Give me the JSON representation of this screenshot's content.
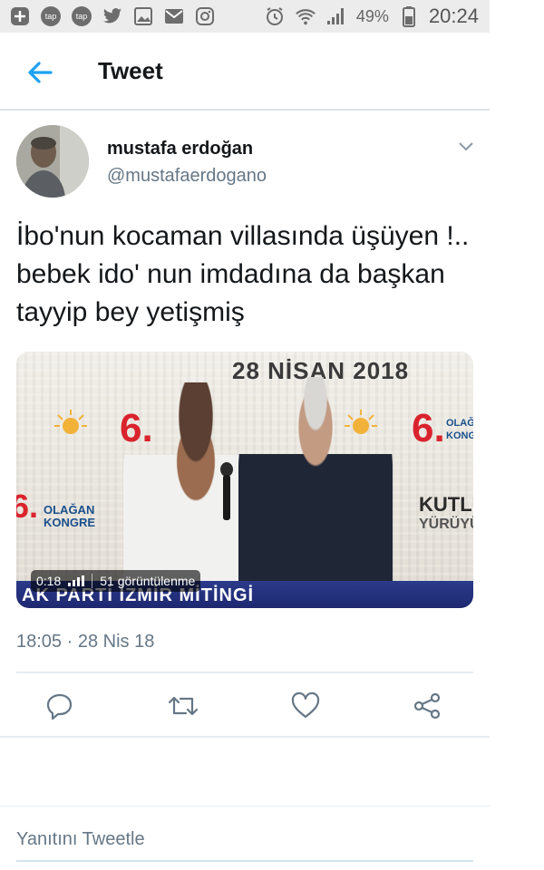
{
  "status_bar": {
    "left_icons": [
      "plus-box-icon",
      "tap-app-icon",
      "tap-app-icon",
      "twitter-icon",
      "gallery-icon",
      "mail-icon",
      "instagram-icon"
    ],
    "tap_label_1": "tap",
    "tap_label_2": "tap",
    "battery_percent": "49%",
    "time": "20:24"
  },
  "header": {
    "title": "Tweet"
  },
  "tweet": {
    "author_name": "mustafa erdoğan",
    "author_handle": "@mustafaerdogano",
    "text": "İbo'nun kocaman villasında üşüyen !.. bebek ido' nun imdadına da başkan tayyip bey yetişmiş",
    "timestamp": "18:05 · 28 Nis 18"
  },
  "media": {
    "date_banner": "28 NİSAN 2018",
    "big_number": "6.",
    "olagan_kongre": "OLAĞAN KONGRE",
    "kutlu": "KUTLU",
    "yuruyus": "YÜRÜYÜŞ",
    "bottom_banner": "AK PARTİ İZMİR MİTİNGİ",
    "duration": "0:18",
    "views": "51 görüntülenme"
  },
  "actions": {
    "reply": "reply-icon",
    "retweet": "retweet-icon",
    "like": "heart-icon",
    "share": "share-icon"
  },
  "reply_box": {
    "placeholder": "Yanıtını Tweetle"
  },
  "colors": {
    "accent": "#1da1f2",
    "secondary_text": "#657786",
    "divider": "#e6ecf0"
  }
}
